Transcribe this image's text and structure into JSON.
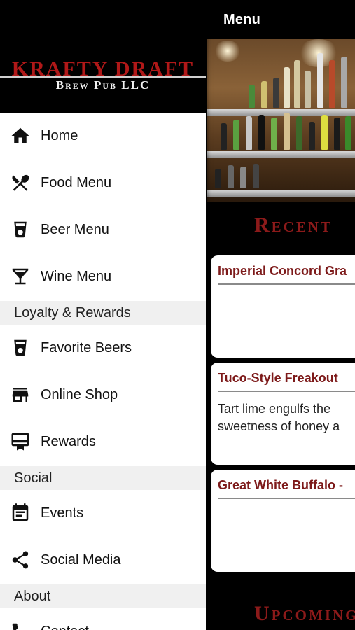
{
  "topbar": {
    "title": "Menu"
  },
  "brand": {
    "name": "KRAFTY DRAFT",
    "sub": "Brew Pub LLC"
  },
  "nav": {
    "home": "Home",
    "food": "Food Menu",
    "beer": "Beer Menu",
    "wine": "Wine Menu",
    "loyalty_header": "Loyalty & Rewards",
    "favorites": "Favorite Beers",
    "shop": "Online Shop",
    "rewards": "Rewards",
    "social_header": "Social",
    "events": "Events",
    "social_media": "Social Media",
    "about_header": "About",
    "contact": "Contact"
  },
  "icons": {
    "home": "home-icon",
    "food": "fork-knife-icon",
    "beer": "beer-glass-icon",
    "wine": "martini-glass-icon",
    "favorites": "beer-glass-icon",
    "shop": "storefront-icon",
    "rewards": "card-icon",
    "events": "calendar-icon",
    "social_media": "share-icon",
    "contact": "phone-icon"
  },
  "main": {
    "recent_heading": "Recent",
    "upcoming_heading": "Upcoming",
    "cards": [
      {
        "title": "Imperial Concord Gra",
        "desc": ""
      },
      {
        "title": "Tuco-Style Freakout",
        "desc": " Tart lime engulfs the\nsweetness of honey a"
      },
      {
        "title": "Great White Buffalo -",
        "desc": ""
      }
    ]
  },
  "colors": {
    "brand_red": "#b01818",
    "heading_red": "#8c1a1a",
    "card_title": "#7d1a1a"
  }
}
